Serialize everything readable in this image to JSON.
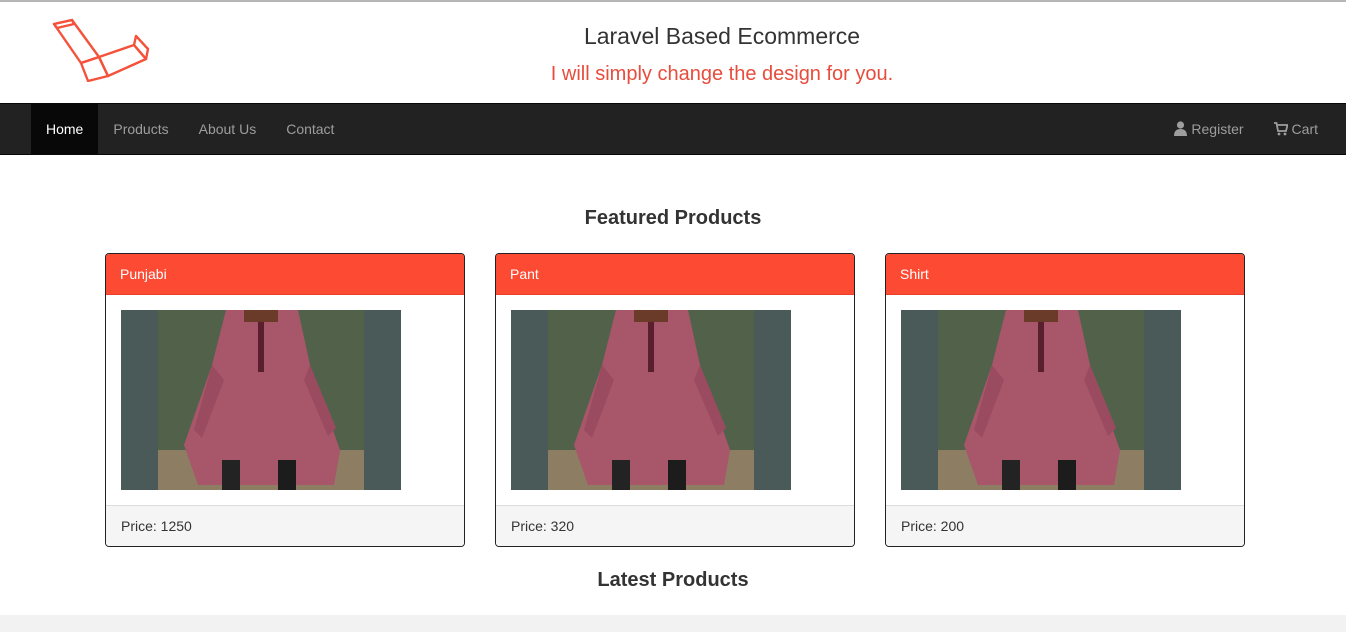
{
  "header": {
    "title": "Laravel Based Ecommerce",
    "tagline": "I will simply change the design for you.",
    "logo_icon": "laravel-logo-icon"
  },
  "nav": {
    "left": [
      {
        "label": "Home",
        "active": true
      },
      {
        "label": "Products",
        "active": false
      },
      {
        "label": "About Us",
        "active": false
      },
      {
        "label": "Contact",
        "active": false
      }
    ],
    "right": [
      {
        "label": "Register",
        "icon": "user-icon"
      },
      {
        "label": "Cart",
        "icon": "shopping-cart-icon"
      }
    ]
  },
  "featured": {
    "title": "Featured Products",
    "products": [
      {
        "name": "Punjabi",
        "price": "Price: 1250"
      },
      {
        "name": "Pant",
        "price": "Price: 320"
      },
      {
        "name": "Shirt",
        "price": "Price: 200"
      }
    ]
  },
  "latest": {
    "title": "Latest Products"
  },
  "colors": {
    "brand_red": "#fc4a33",
    "tagline_red": "#e74c3c",
    "navbar_bg": "#222222"
  }
}
